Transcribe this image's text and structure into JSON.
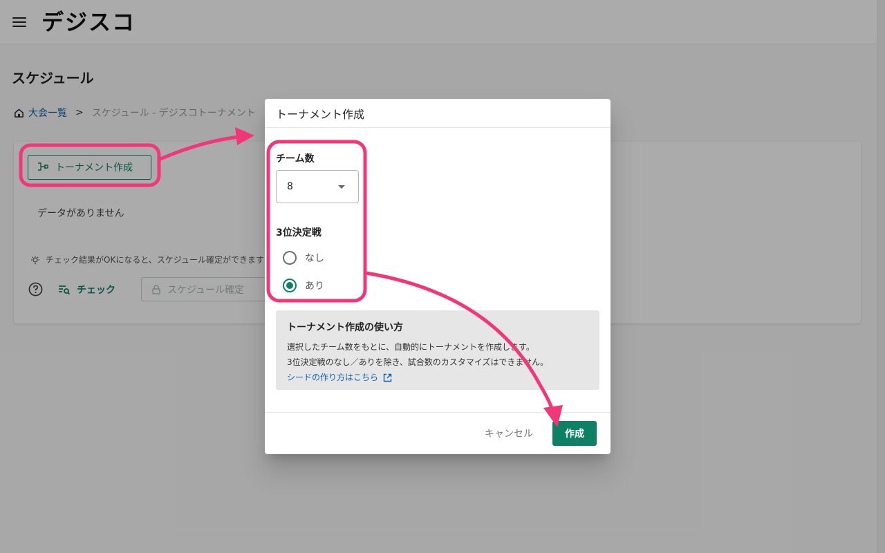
{
  "app": {
    "logo_text": "デジスコ"
  },
  "page": {
    "title": "スケジュール"
  },
  "breadcrumb": {
    "home_label": "大会一覧",
    "separator": ">",
    "current": "スケジュール - デジスコトーナメント"
  },
  "card": {
    "create_button_label": "トーナメント作成",
    "empty_text": "データがありません",
    "tip_text": "チェック結果がOKになると、スケジュール確定ができます",
    "check_button_label": "チェック",
    "confirm_button_label": "スケジュール確定"
  },
  "dialog": {
    "title": "トーナメント作成",
    "team_count_label": "チーム数",
    "team_count_value": "8",
    "third_place_label": "3位決定戦",
    "third_place_options": [
      {
        "label": "なし",
        "checked": false
      },
      {
        "label": "あり",
        "checked": true
      }
    ],
    "info": {
      "title": "トーナメント作成の使い方",
      "line1": "選択したチーム数をもとに、自動的にトーナメントを作成します。",
      "line2": "3位決定戦のなし／ありを除き、試合数のカスタマイズはできません。",
      "link_text": "シードの作り方はこちら"
    },
    "cancel_label": "キャンセル",
    "create_label": "作成"
  },
  "colors": {
    "primary": "#0d8065",
    "link": "#0f5fae",
    "annotation": "#f2367a",
    "logo_accent": "#e0262a"
  },
  "icons": {
    "menu": "hamburger-icon",
    "home": "home-icon",
    "tournament": "tournament-bracket-icon",
    "tip": "lightbulb-icon",
    "help": "help-circle-icon",
    "check": "checklist-search-icon",
    "lock": "lock-icon",
    "dropdown": "caret-down-icon",
    "external": "external-link-icon"
  }
}
